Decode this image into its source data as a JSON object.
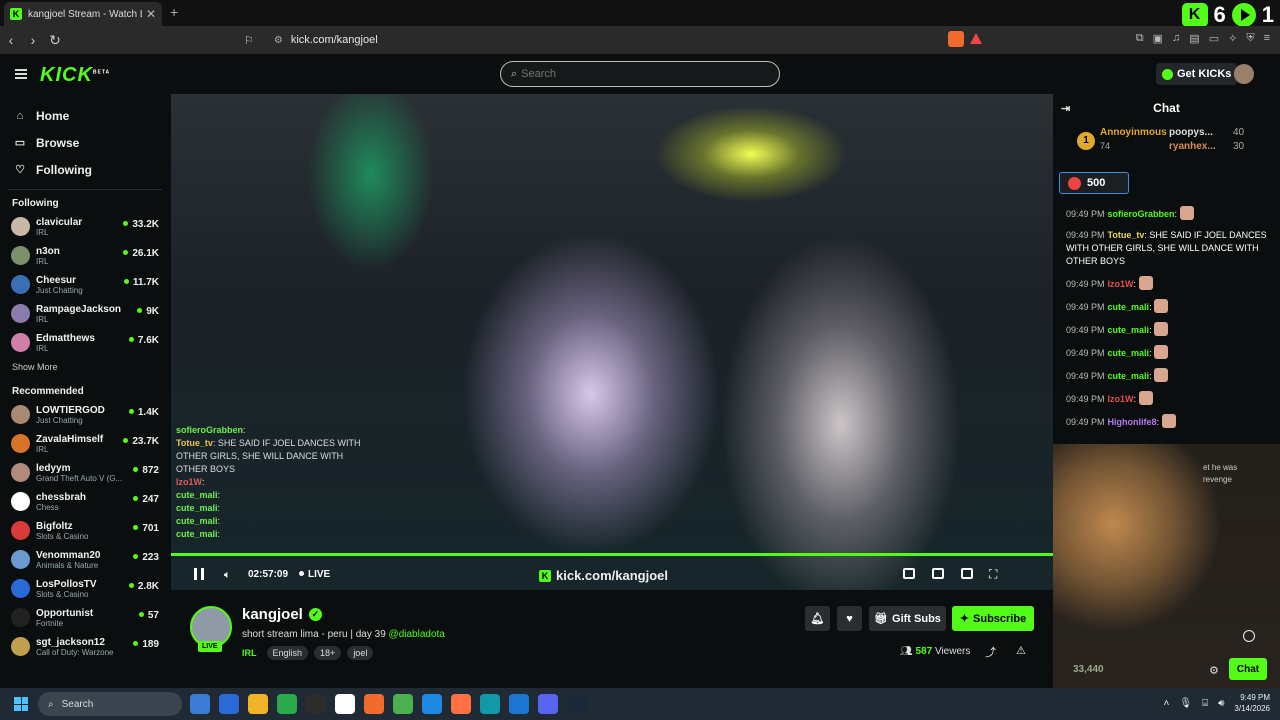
{
  "browser": {
    "tab_title": "kangjoel Stream - Watch Live",
    "url": "kick.com/kangjoel",
    "badge_count": "6",
    "badge_count2": "1"
  },
  "header": {
    "logo": "KICK",
    "logo_beta": "BETA",
    "search_placeholder": "Search",
    "get_kicks": "Get KICKs"
  },
  "sidebar": {
    "nav": [
      {
        "label": "Home",
        "icon": "home-icon"
      },
      {
        "label": "Browse",
        "icon": "browse-icon"
      },
      {
        "label": "Following",
        "icon": "heart-icon"
      }
    ],
    "following_title": "Following",
    "following": [
      {
        "name": "clavicular",
        "category": "IRL",
        "viewers": "33.2K",
        "color": "#c8b8a8"
      },
      {
        "name": "n3on",
        "category": "IRL",
        "viewers": "26.1K",
        "color": "#7a8f6a"
      },
      {
        "name": "Cheesur",
        "category": "Just Chatting",
        "viewers": "11.7K",
        "color": "#3b6fb5"
      },
      {
        "name": "RampageJackson",
        "category": "IRL",
        "viewers": "9K",
        "color": "#8a7cae"
      },
      {
        "name": "Edmatthews",
        "category": "IRL",
        "viewers": "7.6K",
        "color": "#d080a8"
      }
    ],
    "show_more": "Show More",
    "recommended_title": "Recommended",
    "recommended": [
      {
        "name": "LOWTIERGOD",
        "category": "Just Chatting",
        "viewers": "1.4K",
        "color": "#a88a70"
      },
      {
        "name": "ZavalaHimself",
        "category": "IRL",
        "viewers": "23.7K",
        "color": "#d8742a"
      },
      {
        "name": "ledyym",
        "category": "Grand Theft Auto V (G...",
        "viewers": "872",
        "color": "#b08a7a"
      },
      {
        "name": "chessbrah",
        "category": "Chess",
        "viewers": "247",
        "color": "#ffffff"
      },
      {
        "name": "Bigfoltz",
        "category": "Slots & Casino",
        "viewers": "701",
        "color": "#d83a3a"
      },
      {
        "name": "Venomman20",
        "category": "Animals & Nature",
        "viewers": "223",
        "color": "#6a9ad0"
      },
      {
        "name": "LosPollosTV",
        "category": "Slots & Casino",
        "viewers": "2.8K",
        "color": "#2a6ad8"
      },
      {
        "name": "Opportunist",
        "category": "Fortnite",
        "viewers": "57",
        "color": "#222222"
      },
      {
        "name": "sgt_jackson12",
        "category": "Call of Duty: Warzone",
        "viewers": "189",
        "color": "#c0a050"
      }
    ]
  },
  "video": {
    "time": "02:57:09",
    "live": "LIVE",
    "watermark": "kick.com/kangjoel",
    "overlay_chat": [
      {
        "user": "sofieroGrabben",
        "text": ""
      },
      {
        "user": "Totue_tv",
        "text": "SHE SAID IF JOEL DANCES WITH OTHER GIRLS, SHE WILL DANCE WITH OTHER BOYS"
      },
      {
        "user": "Izo1W",
        "text": ""
      },
      {
        "user": "cute_mali",
        "text": ""
      },
      {
        "user": "cute_mali",
        "text": ""
      },
      {
        "user": "cute_mali",
        "text": ""
      },
      {
        "user": "cute_mali",
        "text": ""
      }
    ]
  },
  "stream": {
    "name": "kangjoel",
    "live_badge": "LIVE",
    "title": "short stream lima - peru | day 39",
    "mention": "@diabladota",
    "category": "IRL",
    "tags": [
      "English",
      "18+",
      "joel"
    ],
    "gift_subs": "Gift Subs",
    "subscribe": "Subscribe",
    "viewers": "587",
    "viewers_label": "Viewers"
  },
  "chat": {
    "title": "Chat",
    "leader": {
      "rank": "1",
      "top_name": "Annoyinmous",
      "top_value": "74",
      "second_name": "poopys...",
      "second_value": "40",
      "third_name": "ryanhex...",
      "third_value": "30"
    },
    "pinned_value": "500",
    "messages": [
      {
        "time": "09:49 PM",
        "user": "sofieroGrabben",
        "cls": "",
        "text": "",
        "emote": true
      },
      {
        "time": "09:49 PM",
        "user": "Totue_tv",
        "cls": "gold",
        "text": "SHE SAID IF JOEL DANCES WITH OTHER GIRLS, SHE WILL DANCE WITH OTHER BOYS",
        "emote": false
      },
      {
        "time": "09:49 PM",
        "user": "Izo1W",
        "cls": "red",
        "text": "",
        "emote": true
      },
      {
        "time": "09:49 PM",
        "user": "cute_mali",
        "cls": "",
        "text": "",
        "emote": true
      },
      {
        "time": "09:49 PM",
        "user": "cute_mali",
        "cls": "",
        "text": "",
        "emote": true
      },
      {
        "time": "09:49 PM",
        "user": "cute_mali",
        "cls": "",
        "text": "",
        "emote": true
      },
      {
        "time": "09:49 PM",
        "user": "cute_mali",
        "cls": "",
        "text": "",
        "emote": true
      },
      {
        "time": "09:49 PM",
        "user": "Izo1W",
        "cls": "red",
        "text": "",
        "emote": true
      },
      {
        "time": "09:49 PM",
        "user": "Highonlife8",
        "cls": "purple",
        "text": "",
        "emote": true
      }
    ],
    "cam_text_1": "et he was",
    "cam_text_2": "revenge",
    "points": "33,440",
    "chat_button": "Chat"
  },
  "taskbar": {
    "search": "Search",
    "time": "9:49 PM",
    "date": "3/14/2026",
    "app_colors": [
      "#3a7bd5",
      "#2a6ad8",
      "#f0b429",
      "#2aa84a",
      "#2c2c2c",
      "#ffffff",
      "#f06b2c",
      "#4caf50",
      "#1e88e5",
      "#ff7043",
      "#0f9aa8",
      "#1976d2",
      "#5865f2",
      "#1b2838"
    ]
  }
}
